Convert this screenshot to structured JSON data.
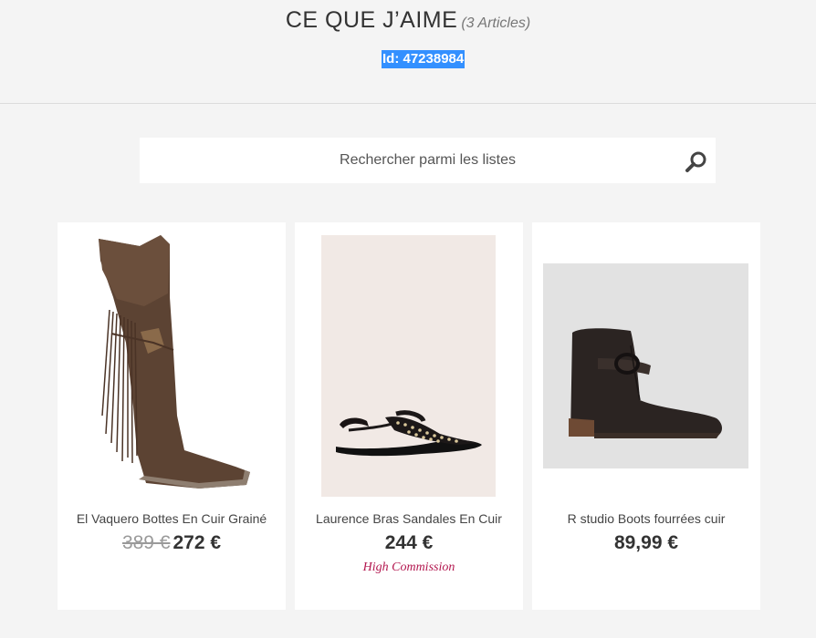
{
  "header": {
    "title": "CE QUE J’AIME",
    "count": "(3 Articles)",
    "list_id": "Id: 47238984"
  },
  "search": {
    "placeholder": "Rechercher parmi les listes",
    "icon": "search-icon"
  },
  "products": [
    {
      "name": "El Vaquero Bottes En Cuir Grainé",
      "old_price": "389 €",
      "price": "272 €",
      "badge": "",
      "image": "brown fringed over-the-knee boot"
    },
    {
      "name": "Laurence Bras Sandales En Cuir",
      "old_price": "",
      "price": "244 €",
      "badge": "High Commission",
      "image": "black studded flat sandal"
    },
    {
      "name": "R studio Boots fourrées cuir",
      "old_price": "",
      "price": "89,99 €",
      "badge": "",
      "image": "black suede ankle boot with buckle strap"
    }
  ],
  "colors": {
    "background": "#f4f4f4",
    "selection": "#3390ff",
    "commission": "#b3174f"
  }
}
